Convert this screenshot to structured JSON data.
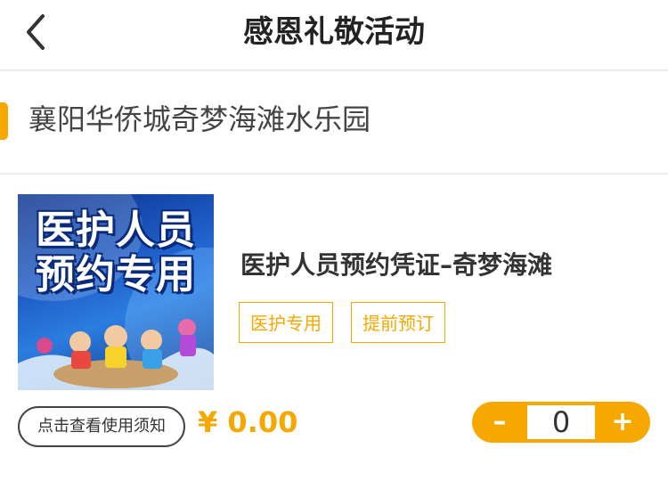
{
  "header": {
    "title": "感恩礼敬活动",
    "back_icon": "chevron-left-icon"
  },
  "venue": {
    "name": "襄阳华侨城奇梦海滩水乐园",
    "accent_color": "#f7a800"
  },
  "product": {
    "image_text_line1": "医护人员",
    "image_text_line2": "预约专用",
    "title": "医护人员预约凭证–奇梦海滩",
    "tags": [
      "医护专用",
      "提前预订"
    ],
    "notice_label": "点击查看使用须知",
    "price": "¥ 0.00"
  },
  "stepper": {
    "minus": "–",
    "plus": "+",
    "quantity": "0"
  }
}
